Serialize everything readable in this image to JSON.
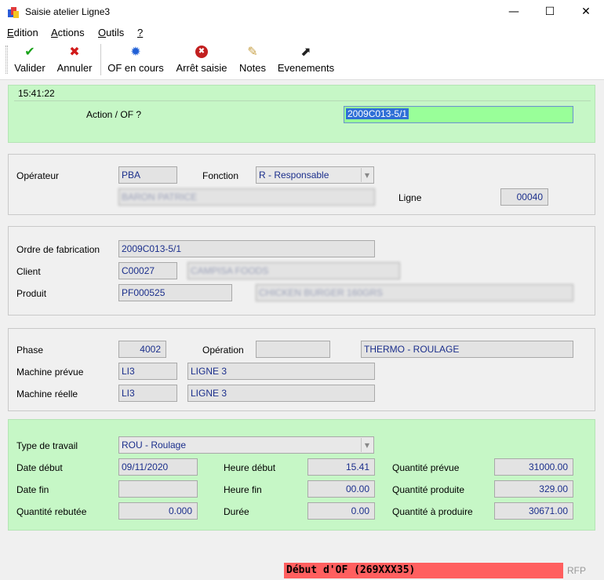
{
  "window": {
    "title": "Saisie atelier Ligne3",
    "minimize": "—",
    "maximize": "☐",
    "close": "✕"
  },
  "menu": {
    "items": [
      {
        "first": "E",
        "rest": "dition"
      },
      {
        "first": "A",
        "rest": "ctions"
      },
      {
        "first": "O",
        "rest": "utils"
      },
      {
        "first": "?",
        "rest": ""
      }
    ]
  },
  "toolbar": {
    "valider": {
      "label": "Valider",
      "icon": "✔",
      "color": "#1aa31a"
    },
    "annuler": {
      "label": "Annuler",
      "icon": "✖",
      "color": "#d11a1a"
    },
    "of_en_cours": {
      "label": "OF en cours",
      "icon": "✹",
      "color": "#1f5fd6"
    },
    "arret_saisie": {
      "label": "Arrêt saisie",
      "icon": "✖",
      "color": "#c21f1f"
    },
    "notes": {
      "label": "Notes",
      "icon": "✎",
      "color": "#c8a24a"
    },
    "evenements": {
      "label": "Evenements",
      "icon": "⬈",
      "color": "#222222"
    }
  },
  "header": {
    "time": "15:41:22",
    "action_label": "Action / OF ?",
    "action_value": "2009C013-5/1"
  },
  "operateur": {
    "label": "Opérateur",
    "code": "PBA",
    "fonction_label": "Fonction",
    "fonction_value": "R - Responsable",
    "name": "BARON PATRICE",
    "ligne_label": "Ligne",
    "ligne_value": "00040"
  },
  "ordre": {
    "of_label": "Ordre de fabrication",
    "of_value": "2009C013-5/1",
    "client_label": "Client",
    "client_code": "C00027",
    "client_name": "CAMPISA FOODS",
    "produit_label": "Produit",
    "produit_code": "PF000525",
    "produit_name": "CHICKEN BURGER 160GRS"
  },
  "phase": {
    "phase_label": "Phase",
    "phase_value": "4002",
    "operation_label": "Opération",
    "operation_code": "",
    "operation_name": "THERMO - ROULAGE",
    "machine_prevue_label": "Machine prévue",
    "machine_prevue_code": "LI3",
    "machine_prevue_name": "LIGNE 3",
    "machine_reelle_label": "Machine réelle",
    "machine_reelle_code": "LI3",
    "machine_reelle_name": "LIGNE 3"
  },
  "travail": {
    "type_label": "Type de travail",
    "type_value": "ROU - Roulage",
    "date_debut_label": "Date début",
    "date_debut_value": "09/11/2020",
    "heure_debut_label": "Heure début",
    "heure_debut_value": "15.41",
    "qte_prevue_label": "Quantité prévue",
    "qte_prevue_value": "31000.00",
    "date_fin_label": "Date fin",
    "date_fin_value": "",
    "heure_fin_label": "Heure fin",
    "heure_fin_value": "00.00",
    "qte_produite_label": "Quantité produite",
    "qte_produite_value": "329.00",
    "qte_rebutee_label": "Quantité rebutée",
    "qte_rebutee_value": "0.000",
    "duree_label": "Durée",
    "duree_value": "0.00",
    "qte_a_produire_label": "Quantité à produire",
    "qte_a_produire_value": "30671.00"
  },
  "status": {
    "message": "Début d'OF (269XXX35)",
    "right": "RFP"
  },
  "colors": {
    "panel_green": "#c6f7c6",
    "action_field": "#99ff99",
    "status_red": "#ff5f5f",
    "field_text": "#1b2f8c"
  }
}
